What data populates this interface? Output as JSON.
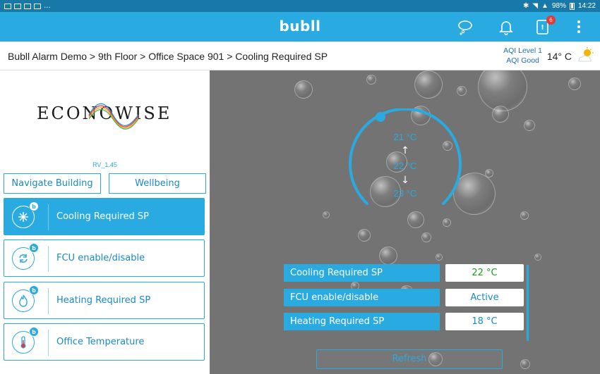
{
  "statusbar": {
    "battery": "98%",
    "time": "14:22",
    "notif_more": "..."
  },
  "appbar": {
    "brand": "bubll",
    "alarm_badge": "6"
  },
  "breadcrumb": {
    "text": "Bubll Alarm Demo > 9th Floor > Office Space 901 > Cooling Required SP"
  },
  "weather": {
    "aqi_level": "AQI Level 1",
    "aqi_status": "AQI Good",
    "temperature": "14° C"
  },
  "sidebar": {
    "logo_text": "ECONOWISE",
    "version": "RV_1.45",
    "navigate_label": "Navigate Building",
    "wellbeing_label": "Wellbeing",
    "items": [
      {
        "label": "Cooling Required SP",
        "badge": "b",
        "icon": "snowflake-icon",
        "active": true
      },
      {
        "label": "FCU enable/disable",
        "badge": "b",
        "icon": "refresh-cycle-icon",
        "active": false
      },
      {
        "label": "Heating Required SP",
        "badge": "b",
        "icon": "flame-icon",
        "active": false
      },
      {
        "label": "Office Temperature",
        "badge": "b",
        "icon": "thermometer-icon",
        "active": false
      }
    ]
  },
  "gauge": {
    "upper": "21 °C",
    "current": "22 °C",
    "lower": "23 °C"
  },
  "datatable": {
    "rows": [
      {
        "label": "Cooling Required SP",
        "value": "22 °C",
        "value_color": "#1a9a1a"
      },
      {
        "label": "FCU enable/disable",
        "value": "Active",
        "value_color": "#1a8ac6"
      },
      {
        "label": "Heating Required SP",
        "value": "18 °C",
        "value_color": "#1a8ac6"
      }
    ]
  },
  "refresh_label": "Refresh",
  "colors": {
    "primary": "#29aae1",
    "statusbar": "#1878a8",
    "background": "#737373"
  }
}
